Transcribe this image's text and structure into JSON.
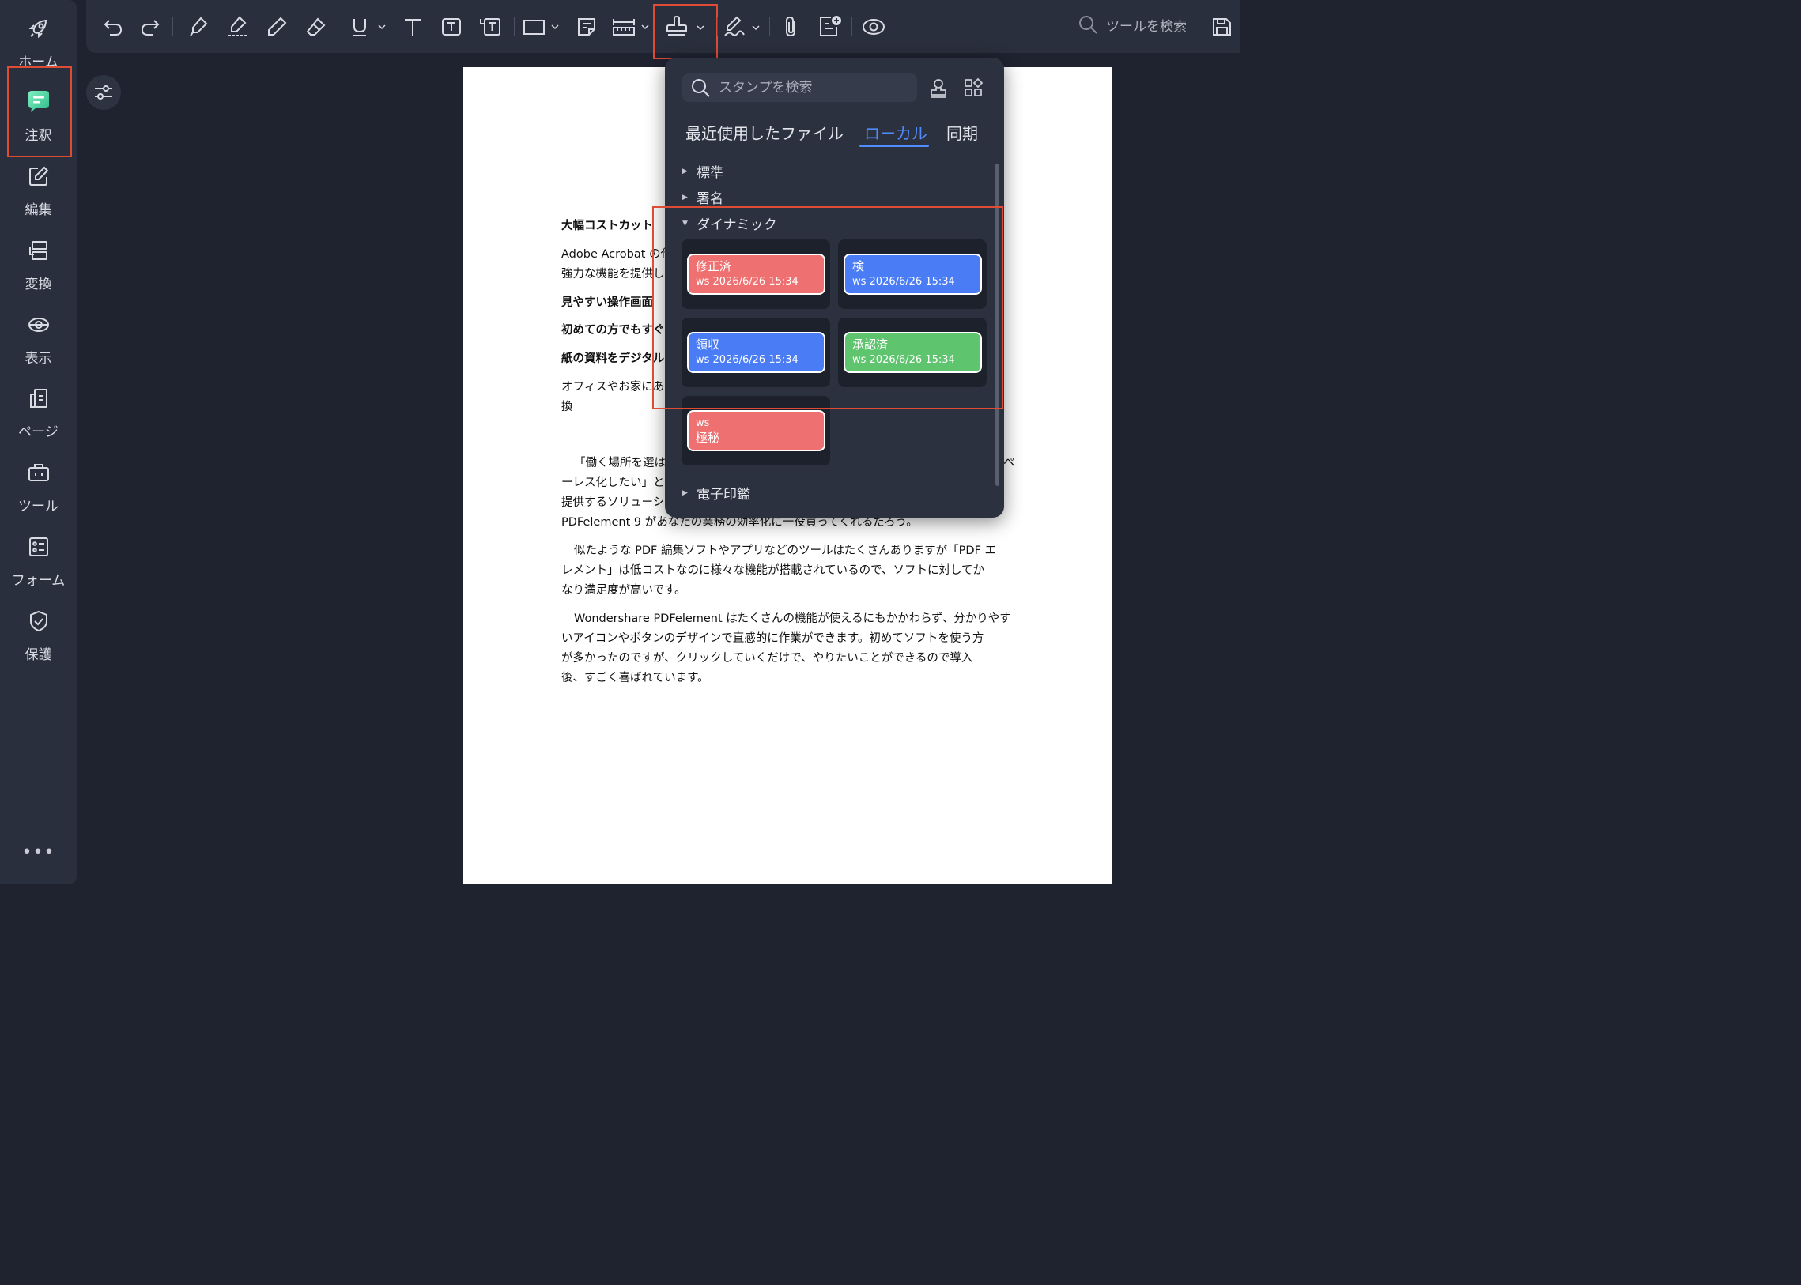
{
  "sidebar": {
    "items": [
      {
        "label": "ホーム",
        "icon": "rocket-icon"
      },
      {
        "label": "注釈",
        "icon": "comment-icon"
      },
      {
        "label": "編集",
        "icon": "edit-icon"
      },
      {
        "label": "変換",
        "icon": "convert-icon"
      },
      {
        "label": "表示",
        "icon": "view-icon"
      },
      {
        "label": "ページ",
        "icon": "pages-icon"
      },
      {
        "label": "ツール",
        "icon": "toolbox-icon"
      },
      {
        "label": "フォーム",
        "icon": "form-icon"
      },
      {
        "label": "保護",
        "icon": "shield-icon"
      }
    ],
    "active_item": "注釈",
    "more_label": "•••"
  },
  "toolbar": {
    "search_placeholder": "ツールを検索",
    "active_tool": "stamp-tool"
  },
  "popup": {
    "search_placeholder": "スタンプを検索",
    "tabs": [
      "最近使用したファイル",
      "ローカル",
      "同期"
    ],
    "active_tab": "ローカル",
    "categories": {
      "standard": "標準",
      "signature": "署名",
      "dynamic": "ダイナミック",
      "seal": "電子印鑑"
    },
    "stamps": [
      {
        "line1": "修正済",
        "line2": "ws 2026/6/26 15:34",
        "color": "#ef7070"
      },
      {
        "line1": "検",
        "line2": "ws 2026/6/26 15:34",
        "color": "#4a7df5"
      },
      {
        "line1": "領収",
        "line2": "ws 2026/6/26 15:34",
        "color": "#4a7df5"
      },
      {
        "line1": "承認済",
        "line2": "ws 2026/6/26 15:34",
        "color": "#5fc46e"
      },
      {
        "line1": "ws",
        "line2": "極秘",
        "color": "#ef7070"
      }
    ]
  },
  "document": {
    "heading1": "大幅コストカット",
    "p1a": "Adobe Acrobat の代",
    "p1b": "強力な機能を提供し",
    "heading2": "見やすい操作画面",
    "heading3": "初めての方でもすぐに",
    "heading4": "紙の資料をデジタル",
    "p2a": "オフィスやお家にあ",
    "p2b": "換",
    "p3a": "「働く場所を選は",
    "p3a_end": "ペ",
    "p3b": "ーレス化したい」と",
    "p3c": "提供するソリューシ",
    "p3d": "PDFelement 9 があなたの業務の効率化に一役買ってくれるだろう。",
    "p4a": "似たような PDF 編集ソフトやアプリなどのツールはたくさんありますが「PDF エ",
    "p4b": "レメント」は低コストなのに様々な機能が搭載されているので、ソフトに対してか",
    "p4c": "なり満足度が高いです。",
    "p5a": "Wondershare PDFelement はたくさんの機能が使えるにもかかわらず、分かりやす",
    "p5b": "いアイコンやボタンのデザインで直感的に作業ができます。初めてソフトを使う方",
    "p5c": "が多かったのですが、クリックしていくだけで、やりたいことができるので導入",
    "p5d": "後、すごく喜ばれています。"
  }
}
